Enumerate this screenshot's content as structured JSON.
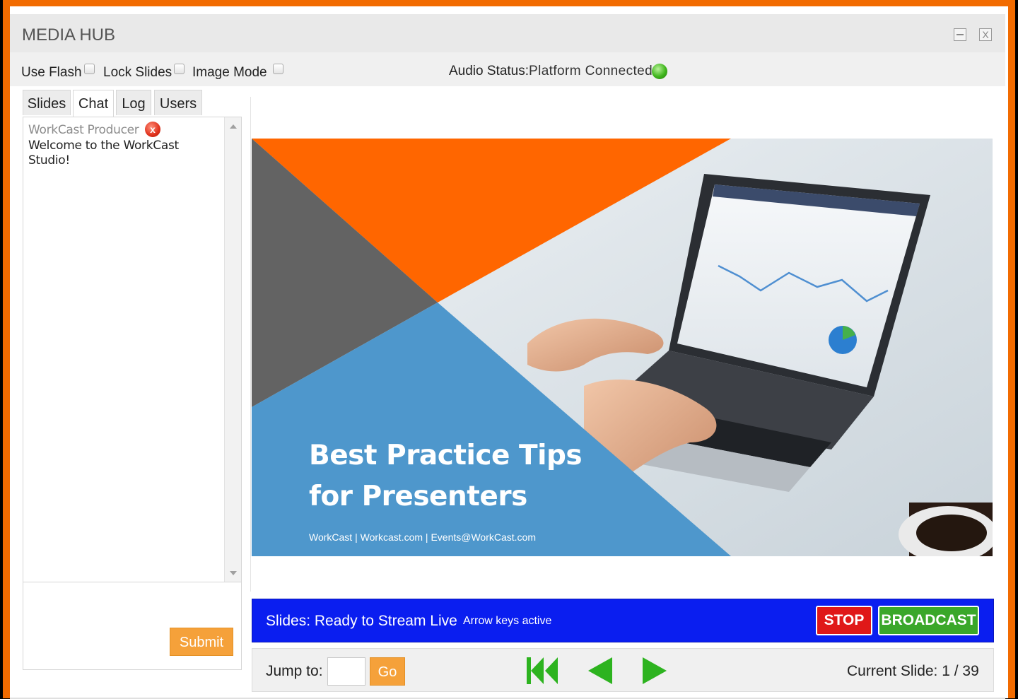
{
  "window": {
    "title": "MEDIA HUB",
    "close_glyph": "X"
  },
  "options": {
    "use_flash": "Use Flash",
    "lock_slides": "Lock Slides",
    "image_mode": "Image Mode",
    "audio_label": "Audio Status:",
    "audio_value": "Platform Connected",
    "audio_status_color": "#3fb51c"
  },
  "tabs": [
    {
      "label": "Slides"
    },
    {
      "label": "Chat"
    },
    {
      "label": "Log"
    },
    {
      "label": "Users"
    }
  ],
  "chat": {
    "messages": [
      {
        "author": "WorkCast Producer",
        "text": "Welcome to the WorkCast Studio!"
      }
    ],
    "delete_glyph": "x",
    "submit_label": "Submit"
  },
  "slide": {
    "title_line1": "Best Practice Tips",
    "title_line2": "for Presenters",
    "footer": "WorkCast | Workcast.com | Events@WorkCast.com",
    "colors": {
      "orange": "#ff6600",
      "gray": "#636363",
      "blue": "#4e97cc"
    }
  },
  "status": {
    "main": "Slides: Ready to Stream Live",
    "sub": "Arrow keys active",
    "stop_label": "STOP",
    "broadcast_label": "BROADCAST",
    "bar_color": "#0a1ef0"
  },
  "navigation": {
    "jump_label": "Jump to:",
    "jump_value": "",
    "go_label": "Go",
    "current_slide": "Current Slide: 1 / 39",
    "icons": [
      "first-slide-icon",
      "previous-slide-icon",
      "next-slide-icon"
    ]
  }
}
